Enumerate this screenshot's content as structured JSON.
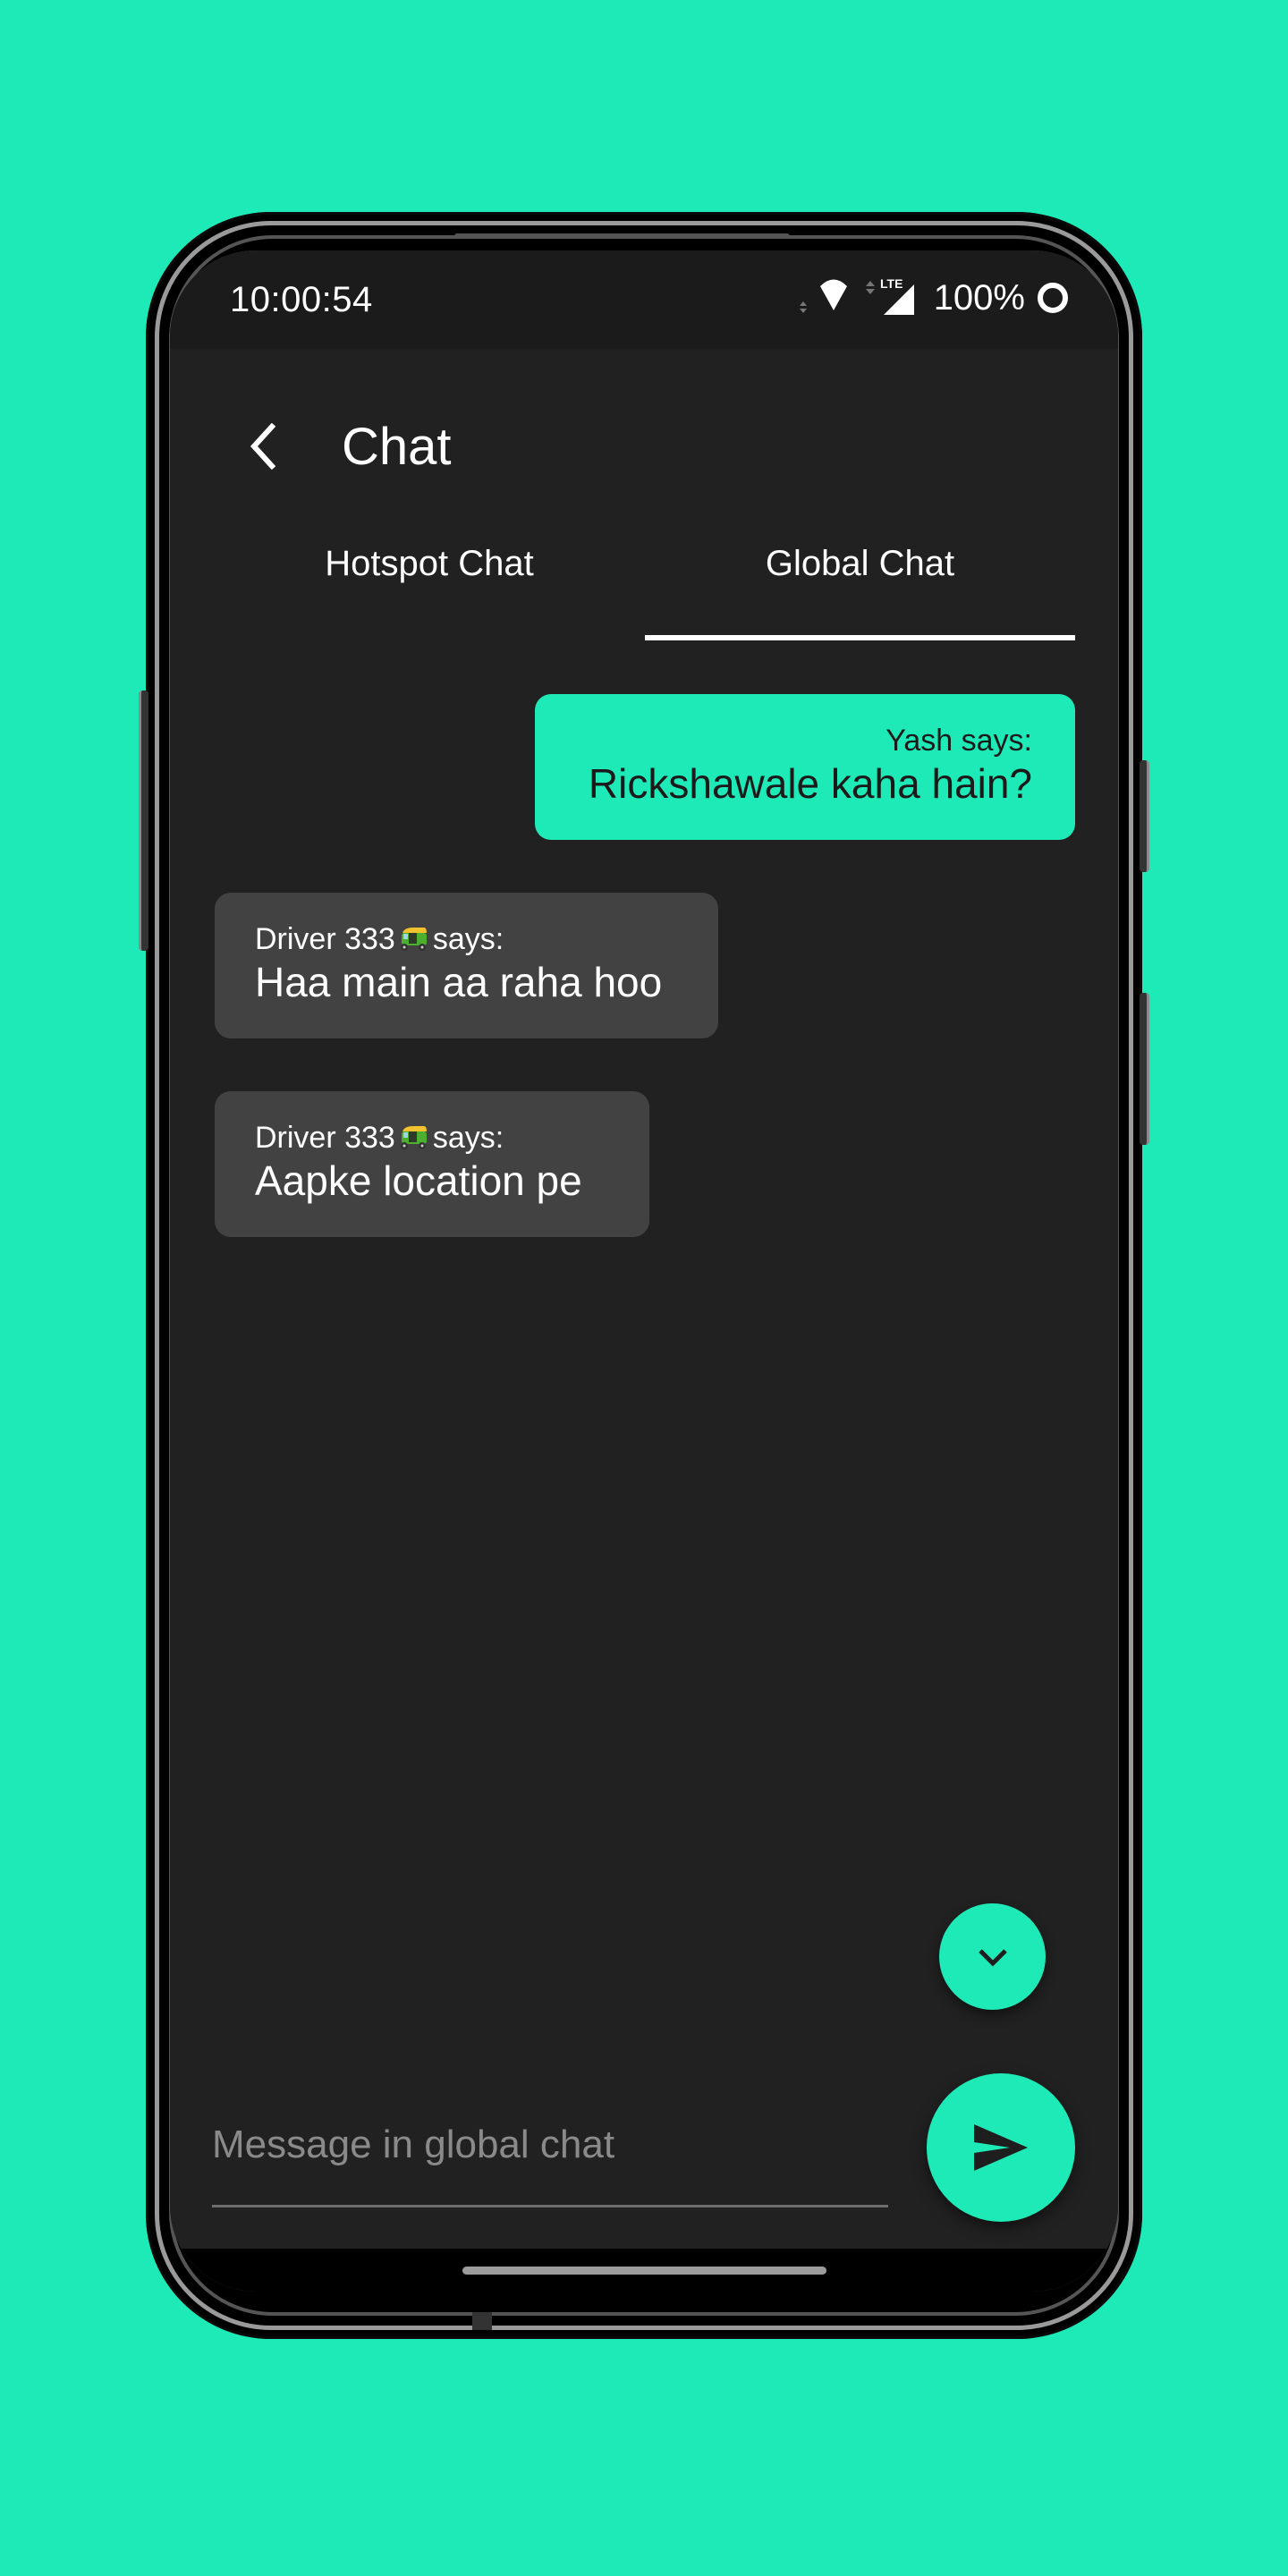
{
  "theme": {
    "accent": "#1eeab8",
    "app_background": "#212121",
    "status_bar_background": "#1b1b1b",
    "incoming_bubble": "#424242",
    "outgoing_text": "#1a1a1a"
  },
  "status_bar": {
    "time": "10:00:54",
    "wifi_icon": "wifi-icon",
    "signal_icon": "cell-signal-icon",
    "network_label": "LTE",
    "battery_percent": "100%",
    "battery_icon": "battery-ring-icon"
  },
  "header": {
    "back_icon": "chevron-left-icon",
    "title": "Chat"
  },
  "tabs": [
    {
      "label": "Hotspot Chat",
      "selected": false
    },
    {
      "label": "Global Chat",
      "selected": true
    }
  ],
  "messages": [
    {
      "direction": "outgoing",
      "sender": "Yash",
      "says_suffix": "says:",
      "sender_emoji": "",
      "text": "Rickshawale kaha hain?"
    },
    {
      "direction": "incoming",
      "sender": "Driver 333",
      "says_suffix": "says:",
      "sender_emoji": "auto-rickshaw",
      "text": "Haa main aa raha hoo"
    },
    {
      "direction": "incoming",
      "sender": "Driver 333",
      "says_suffix": "says:",
      "sender_emoji": "auto-rickshaw",
      "text": "Aapke location pe"
    }
  ],
  "composer": {
    "value": "",
    "placeholder": "Message in global chat",
    "send_icon": "send-icon"
  },
  "scroll_down_button": {
    "icon": "chevron-down-icon"
  }
}
